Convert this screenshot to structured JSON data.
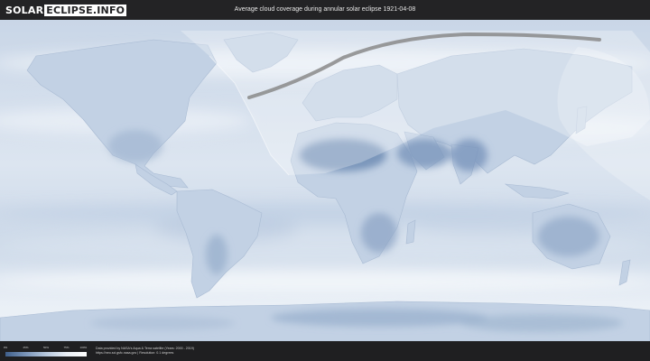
{
  "header": {
    "logo_solar": "SOLAR",
    "logo_eclipse": "ECLIPSE.INFO",
    "title": "Average cloud coverage during annular solar eclipse 1921-04-08"
  },
  "map": {
    "ocean_color": "#d4dfec",
    "land_color": "#c5d3e5",
    "dark_cloud_color": "#5a7aa6",
    "clear_sky_color": "#f4f7fb",
    "eclipse_path_color": "#8a8a8a",
    "visibility_overlay_color": "#ffffff"
  },
  "legend": {
    "ticks": [
      "0%",
      "25%",
      "50%",
      "75%",
      "100%"
    ],
    "gradient_start": "#3f5f8b",
    "gradient_end": "#ffffff"
  },
  "credits": {
    "line1": "Data provided by NASA's Aqua & Terra satellite (Years: 2000 - 2019)",
    "line2": "https://neo.sci.gsfc.nasa.gov | Resolution: 0.1 degrees"
  }
}
